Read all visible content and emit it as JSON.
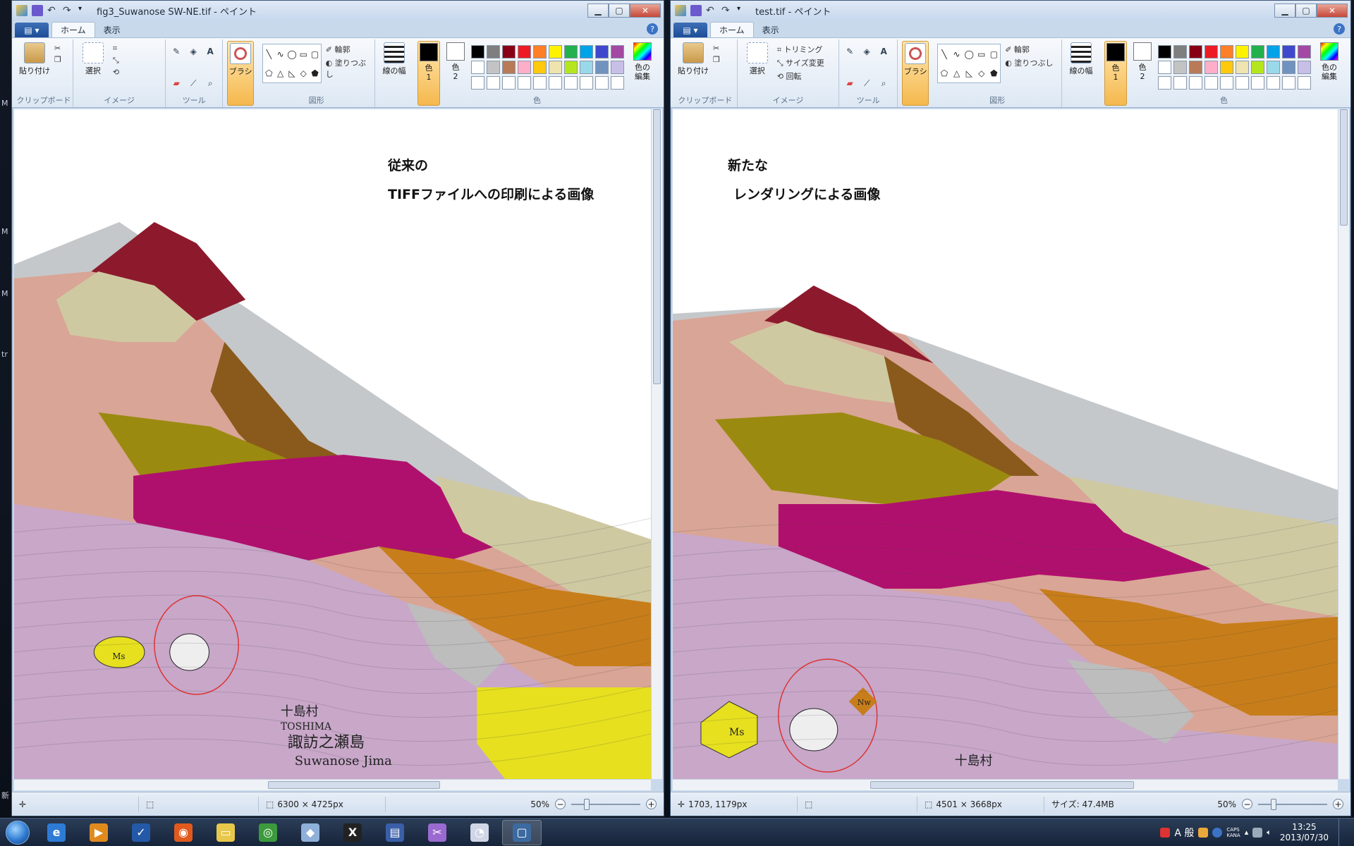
{
  "desktop": {
    "marks": [
      "M",
      "M",
      "M",
      "tr",
      "新"
    ]
  },
  "windows": [
    {
      "title": "fig3_Suwanose SW-NE.tif - ペイント",
      "tabs": [
        "ホーム",
        "表示"
      ],
      "ribbon": {
        "clipboard": {
          "paste": "貼り付け",
          "label": "クリップボード"
        },
        "image": {
          "select": "選択",
          "label": "イメージ",
          "trim": "",
          "resize": "",
          "rotate": ""
        },
        "tools": {
          "label": "ツール"
        },
        "brush": "ブラシ",
        "shapes": {
          "label": "図形",
          "outline": "輪郭",
          "fill": "塗りつぶし"
        },
        "line_width": "線の幅",
        "color1": "色\n1",
        "color2": "色\n2",
        "edit_colors": "色の\n編集",
        "colors_label": "色"
      },
      "overlay_lines": [
        "従来の",
        "TIFFファイルへの印刷による画像"
      ],
      "status": {
        "cursor": "",
        "dimensions": "6300 × 4725px",
        "size": "",
        "zoom": "50%"
      }
    },
    {
      "title": "test.tif - ペイント",
      "tabs": [
        "ホーム",
        "表示"
      ],
      "ribbon": {
        "clipboard": {
          "paste": "貼り付け",
          "label": "クリップボード"
        },
        "image": {
          "select": "選択",
          "label": "イメージ",
          "trim": "トリミング",
          "resize": "サイズ変更",
          "rotate": "回転"
        },
        "tools": {
          "label": "ツール"
        },
        "brush": "ブラシ",
        "shapes": {
          "label": "図形",
          "outline": "輪郭",
          "fill": "塗りつぶし"
        },
        "line_width": "線の幅",
        "color1": "色\n1",
        "color2": "色\n2",
        "edit_colors": "色の\n編集",
        "colors_label": "色"
      },
      "overlay_lines": [
        "新たな",
        "レンダリングによる画像"
      ],
      "status": {
        "cursor": "1703, 1179px",
        "dimensions": "4501 × 3668px",
        "size": "サイズ: 47.4MB",
        "zoom": "50%"
      }
    }
  ],
  "palette": [
    "#000000",
    "#7f7f7f",
    "#880015",
    "#ed1c24",
    "#ff7f27",
    "#fff200",
    "#22b14c",
    "#00a2e8",
    "#3f48cc",
    "#a349a4",
    "#ffffff",
    "#c3c3c3",
    "#b97a57",
    "#ffaec9",
    "#ffc90e",
    "#efe4b0",
    "#b5e61d",
    "#99d9ea",
    "#7092be",
    "#c8bfe7"
  ],
  "map_colors": {
    "sky": "#ffffff",
    "sea": "#c4c8cb",
    "lava": "#b0106d",
    "summit": "#8c1a2c",
    "olive": "#9b8a10",
    "ochre": "#c77e1a",
    "brown": "#8a5a1c",
    "lilac": "#c8a7c9",
    "pink": "#d9a596",
    "beige": "#cfc9a2",
    "yellow": "#e6e01f",
    "grey": "#bdbdbd"
  },
  "map_labels": {
    "left": [
      "十島村",
      "TOSHIMA",
      "諏訪之瀬島",
      "Suwanose Jima",
      "Ms"
    ],
    "right": [
      "Ms",
      "Nw",
      "十島村"
    ]
  },
  "taskbar": {
    "apps": [
      "ie",
      "media",
      "tasks",
      "firefox",
      "explorer",
      "chrome",
      "notes",
      "x",
      "word",
      "paint-tools",
      "paint",
      "window"
    ],
    "active": [
      11
    ],
    "tray_ime": "A 般",
    "caps": "CAPS\nKANA",
    "time": "13:25",
    "date": "2013/07/30"
  }
}
